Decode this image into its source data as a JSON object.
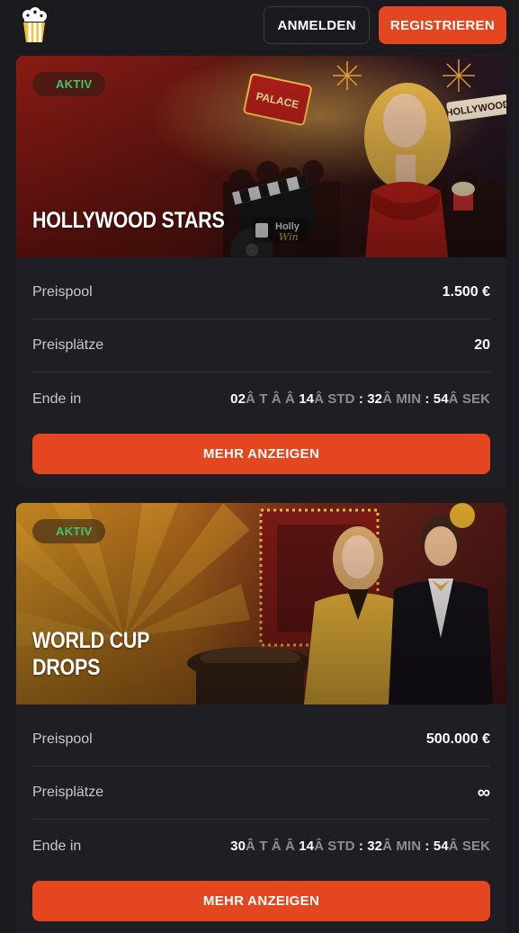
{
  "header": {
    "logo_icon": "popcorn-logo-icon",
    "login_label": "ANMELDEN",
    "register_label": "REGISTRIEREN"
  },
  "colors": {
    "accent": "#e4471f",
    "active_badge": "#3fc66a",
    "background": "#1b1a1f",
    "card": "#1f1e24"
  },
  "tournaments": [
    {
      "status": "AKTIV",
      "title": "HOLLYWOOD STARS",
      "rows": {
        "prize_pool_label": "Preispool",
        "prize_pool_value": "1.500 €",
        "places_label": "Preisplätze",
        "places_value": "20",
        "ends_label": "Ende in"
      },
      "countdown": {
        "d": "02",
        "d_unit": "Â T Â Â",
        "h": "14",
        "h_unit": "Â STD",
        "m": "32",
        "m_unit": "Â MIN",
        "s": "54",
        "s_unit": "Â SEK",
        "sep": " : "
      },
      "more_label": "MEHR ANZEIGEN"
    },
    {
      "status": "AKTIV",
      "title": "WORLD CUP\nDROPS",
      "rows": {
        "prize_pool_label": "Preispool",
        "prize_pool_value": "500.000 €",
        "places_label": "Preisplätze",
        "places_value": "∞",
        "ends_label": "Ende in"
      },
      "countdown": {
        "d": "30",
        "d_unit": "Â T Â Â",
        "h": "14",
        "h_unit": "Â STD",
        "m": "32",
        "m_unit": "Â MIN",
        "s": "54",
        "s_unit": "Â SEK",
        "sep": " : "
      },
      "more_label": "MEHR ANZEIGEN"
    }
  ]
}
